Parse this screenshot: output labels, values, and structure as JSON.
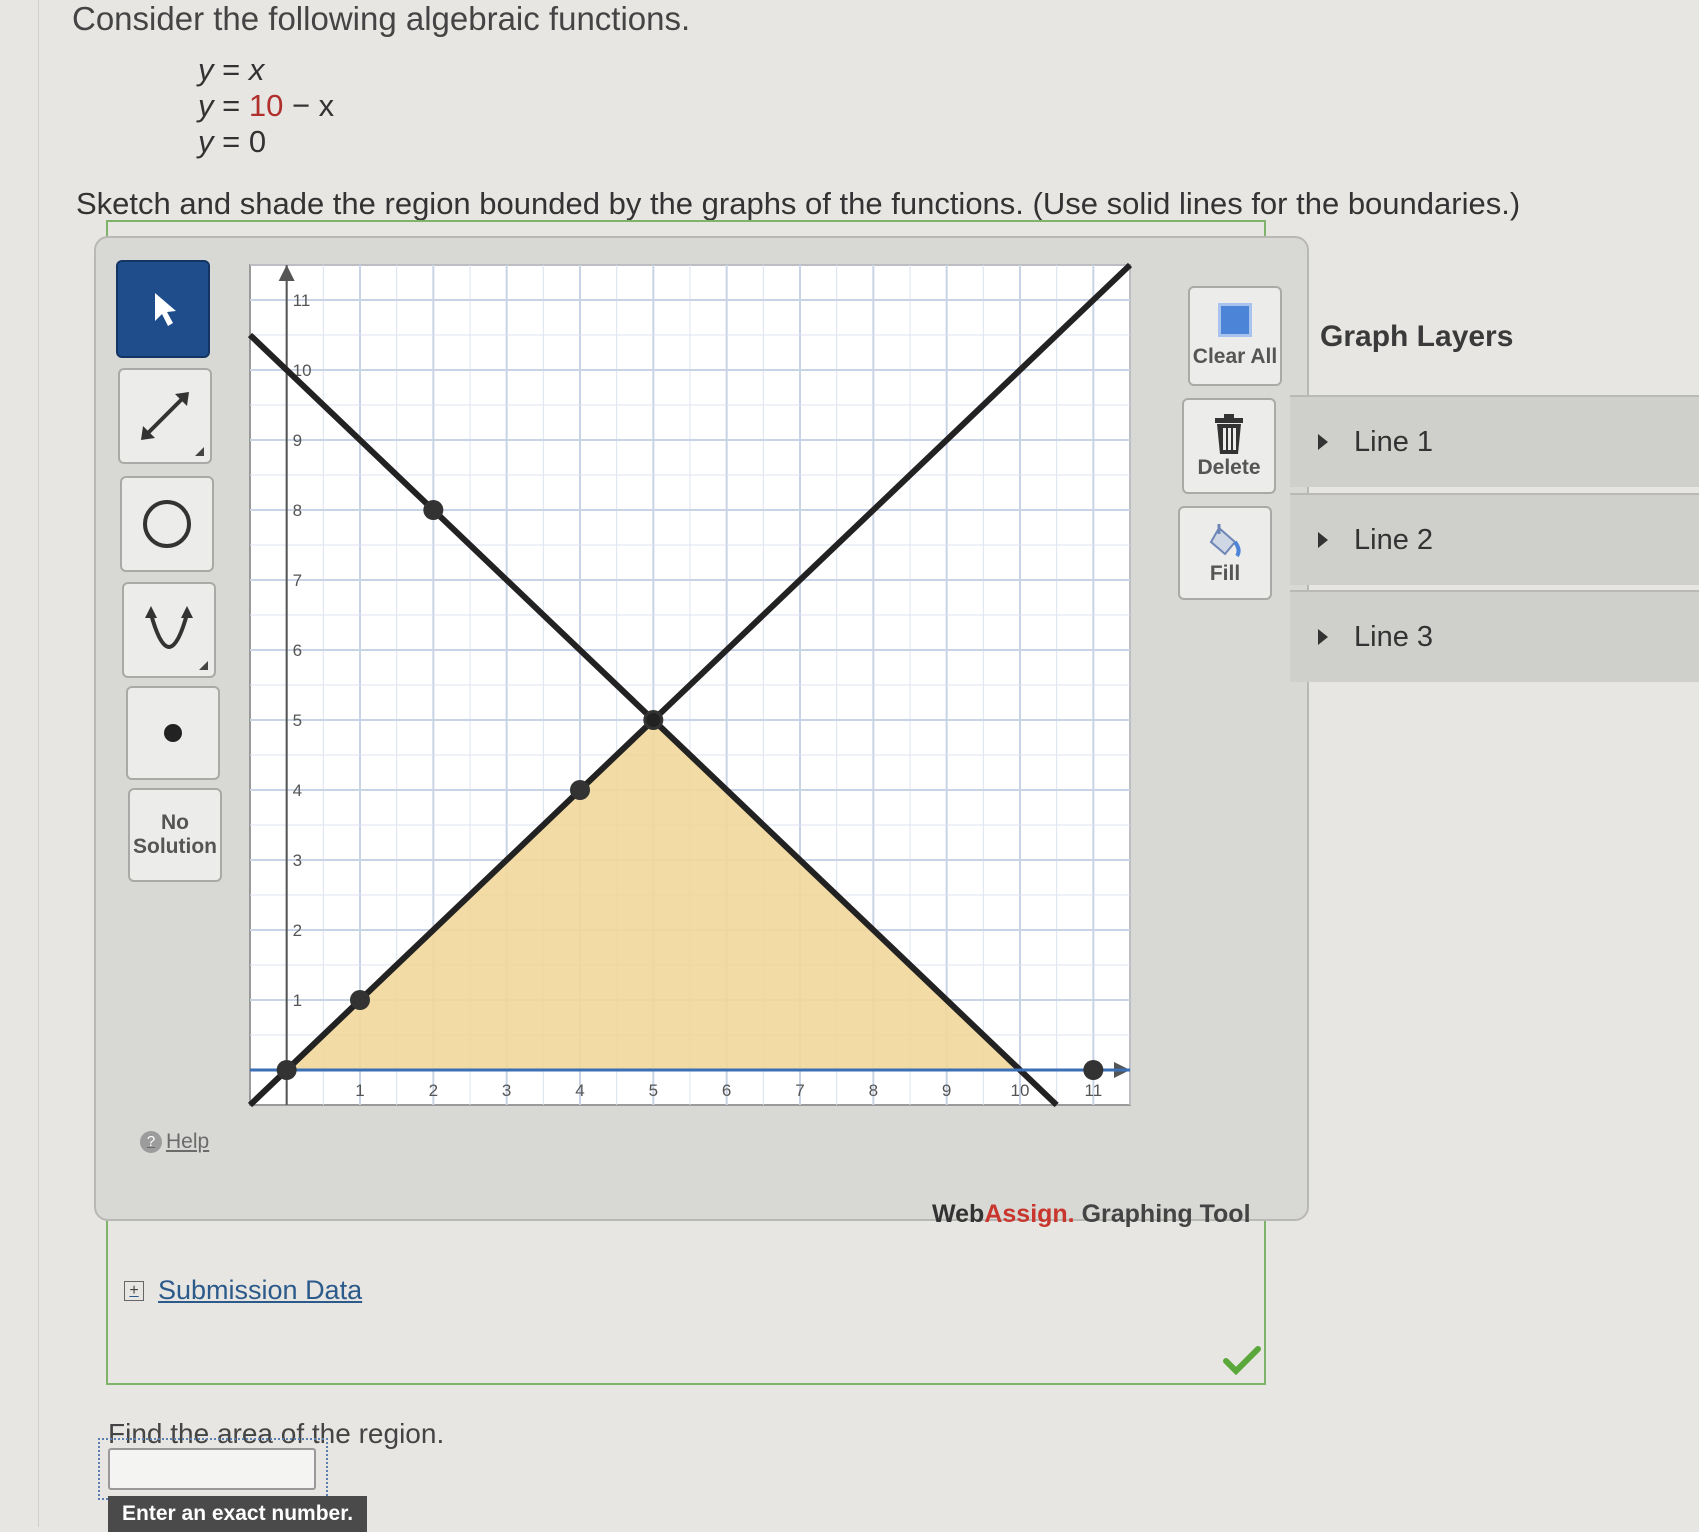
{
  "intro": "Consider the following algebraic functions.",
  "equations": [
    {
      "lhs": "y",
      "eq": " = ",
      "rhs_pre": "x",
      "rhs_red": "",
      "rhs_post": ""
    },
    {
      "lhs": "y",
      "eq": " = ",
      "rhs_pre": "",
      "rhs_red": "10",
      "rhs_post": " − x"
    },
    {
      "lhs": "y",
      "eq": " = ",
      "rhs_pre": "0",
      "rhs_red": "",
      "rhs_post": ""
    }
  ],
  "prompt": "Sketch and shade the region bounded by the graphs of the functions. (Use solid lines for the boundaries.)",
  "toolbar": {
    "no_solution_line1": "No",
    "no_solution_line2": "Solution",
    "help": "Help"
  },
  "side_buttons": {
    "clear_all": "Clear All",
    "delete": "Delete",
    "fill": "Fill"
  },
  "brand": {
    "web": "Web",
    "assign": "Assign.",
    "tool": " Graphing Tool"
  },
  "graph_layers": {
    "title": "Graph Layers",
    "items": [
      "Line 1",
      "Line 2",
      "Line 3"
    ]
  },
  "chart_data": {
    "type": "line",
    "xlim": [
      -0.5,
      11.5
    ],
    "ylim": [
      -0.5,
      11.5
    ],
    "x_ticks": [
      "1",
      "2",
      "3",
      "4",
      "5",
      "6",
      "7",
      "8",
      "9",
      "10",
      "11"
    ],
    "y_ticks": [
      "1",
      "2",
      "3",
      "4",
      "5",
      "6",
      "7",
      "8",
      "9",
      "10",
      "11"
    ],
    "grid": true,
    "series": [
      {
        "equation": "y = x",
        "points": [
          [
            1,
            1
          ],
          [
            4,
            4
          ]
        ],
        "color": "#222222"
      },
      {
        "equation": "y = 10 - x",
        "points": [
          [
            2,
            8
          ],
          [
            5,
            5
          ]
        ],
        "color": "#222222"
      },
      {
        "equation": "y = 0",
        "points": [
          [
            0,
            0
          ],
          [
            11,
            0
          ]
        ],
        "color": "#3b6fb6"
      }
    ],
    "shaded_region": {
      "vertices": [
        [
          0,
          0
        ],
        [
          5,
          5
        ],
        [
          10,
          0
        ]
      ],
      "color": "#f1d79a"
    }
  },
  "submission_label": "Submission Data",
  "question": "Find the area of the region.",
  "answer": {
    "value": "",
    "hint": "Enter an exact number."
  }
}
